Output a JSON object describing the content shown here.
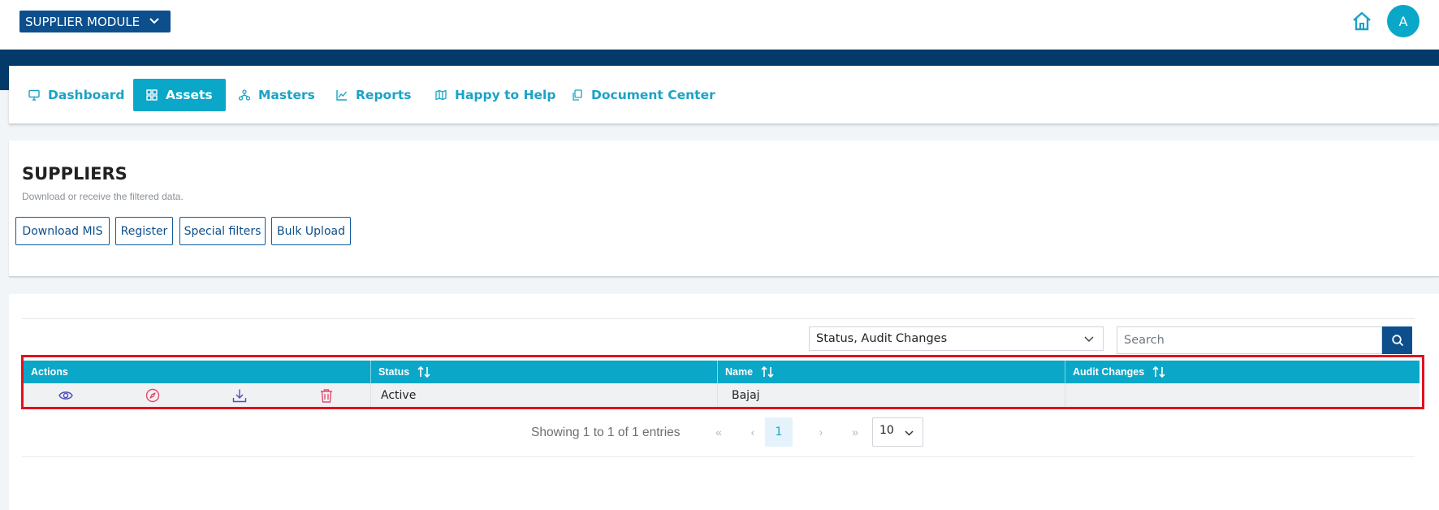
{
  "header": {
    "module_label": "SUPPLIER MODULE",
    "avatar_initial": "A"
  },
  "nav": {
    "items": [
      {
        "label": "Dashboard",
        "icon": "monitor-icon"
      },
      {
        "label": "Assets",
        "icon": "grid-icon",
        "active": true
      },
      {
        "label": "Masters",
        "icon": "hierarchy-icon"
      },
      {
        "label": "Reports",
        "icon": "chart-icon"
      },
      {
        "label": "Happy to Help",
        "icon": "map-icon"
      },
      {
        "label": "Document Center",
        "icon": "copy-icon"
      }
    ]
  },
  "page": {
    "title": "SUPPLIERS",
    "subtitle": "Download or receive the filtered data.",
    "buttons": [
      "Download MIS",
      "Register",
      "Special filters",
      "Bulk Upload"
    ]
  },
  "table": {
    "column_filter_value": "Status, Audit Changes",
    "search_placeholder": "Search",
    "columns": [
      "Actions",
      "Status",
      "Name",
      "Audit Changes"
    ],
    "rows": [
      {
        "status": "Active",
        "name": "Bajaj",
        "audit_changes": ""
      }
    ],
    "row_actions": [
      "eye-icon",
      "compass-icon",
      "download-icon",
      "trash-icon"
    ]
  },
  "pagination": {
    "summary": "Showing 1 to 1 of 1 entries",
    "first": "«",
    "prev": "‹",
    "current_page": "1",
    "next": "›",
    "last": "»",
    "page_size": "10"
  },
  "colors": {
    "primary_dark": "#0c4f8c",
    "accent": "#0aa7c8",
    "band": "#043a6a",
    "highlight": "#e4101c",
    "danger": "#e24a6f"
  }
}
